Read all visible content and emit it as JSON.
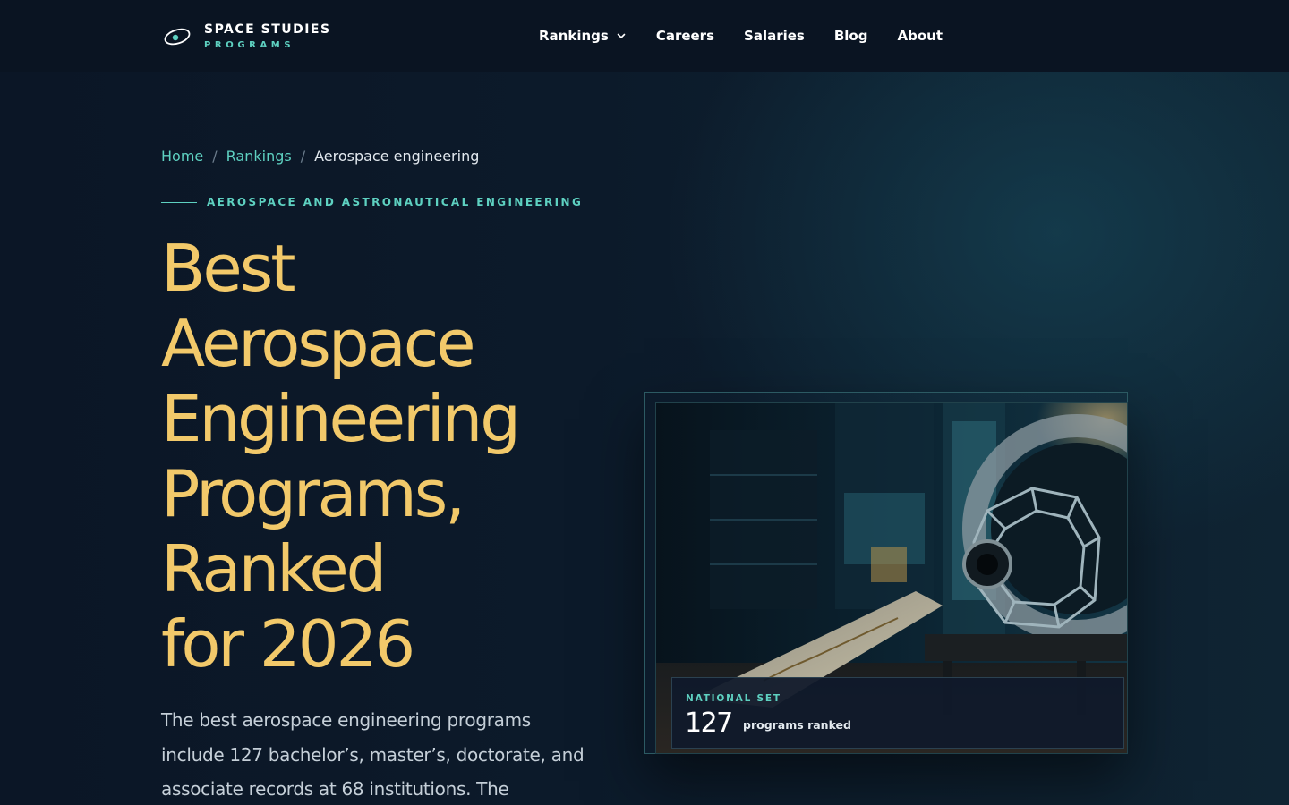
{
  "brand": {
    "title": "SPACE STUDIES",
    "subtitle": "PROGRAMS",
    "icon": "orbit-eye-icon"
  },
  "nav": {
    "items": [
      {
        "label": "Rankings",
        "has_dropdown": true
      },
      {
        "label": "Careers"
      },
      {
        "label": "Salaries"
      },
      {
        "label": "Blog"
      },
      {
        "label": "About"
      }
    ]
  },
  "breadcrumb": {
    "home": "Home",
    "rankings": "Rankings",
    "separator": "/",
    "current": "Aerospace engineering"
  },
  "eyebrow": "AEROSPACE AND ASTRONAUTICAL ENGINEERING",
  "headline": {
    "lines": [
      "Best",
      "Aerospace",
      "Engineering",
      "Programs,",
      "Ranked",
      "for 2026"
    ]
  },
  "intro": "The best aerospace engineering programs include 127 bachelor’s, master’s, doctorate, and associate records at 68 institutions. The",
  "card": {
    "image": "spacecraft-lab-photo",
    "stat_label": "NATIONAL SET",
    "stat_value": "127",
    "stat_caption": "programs ranked"
  },
  "colors": {
    "accent_teal": "#5ed1c1",
    "headline_gold": "#f2c96a",
    "background": "#0b1726"
  }
}
